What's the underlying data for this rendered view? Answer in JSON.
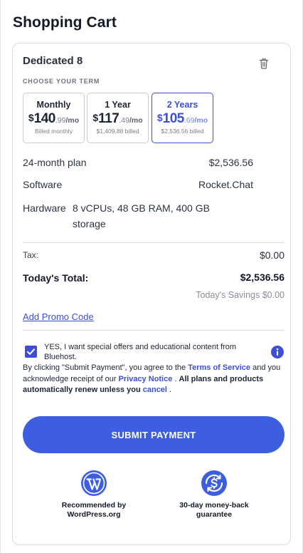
{
  "page": {
    "title": "Shopping Cart"
  },
  "cart": {
    "product_name": "Dedicated 8",
    "term_section_label": "CHOOSE YOUR TERM",
    "terms": [
      {
        "name": "Monthly",
        "currency": "$",
        "dollars": "140",
        "cents": ".99",
        "per": "/mo",
        "billed": "Billed monthly",
        "selected": false
      },
      {
        "name": "1 Year",
        "currency": "$",
        "dollars": "117",
        "cents": ".49",
        "per": "/mo",
        "billed": "$1,409.88 billed",
        "selected": false
      },
      {
        "name": "2 Years",
        "currency": "$",
        "dollars": "105",
        "cents": ".69",
        "per": "/mo",
        "billed": "$2,536.56 billed",
        "selected": true
      }
    ],
    "details": {
      "plan_label": "24-month plan",
      "plan_value": "$2,536.56",
      "software_label": "Software",
      "software_value": "Rocket.Chat",
      "hardware_label": "Hardware",
      "hardware_value": "8 vCPUs, 48 GB RAM, 400 GB storage"
    },
    "tax_label": "Tax:",
    "tax_value": "$0.00",
    "total_label": "Today's Total:",
    "total_value": "$2,536.56",
    "savings_text": "Today's Savings $0.00",
    "promo_link": "Add Promo Code",
    "optin": {
      "checked": true,
      "text": "YES, I want special offers and educational content from Bluehost."
    },
    "legal": {
      "part1": "By clicking \"Submit Payment\", you agree to the ",
      "tos_link": "Terms of Service",
      "part2": " and you acknowledge receipt of our ",
      "privacy_link": "Privacy Notice",
      "part3": " . ",
      "bold": " All plans and products automatically renew unless you ",
      "cancel_link": "cancel",
      "part4": " ."
    },
    "submit_label": "SUBMIT PAYMENT",
    "badges": [
      {
        "icon": "wordpress-icon",
        "caption": "Recommended by WordPress.org"
      },
      {
        "icon": "money-back-icon",
        "caption": "30-day money-back guarantee"
      }
    ]
  },
  "colors": {
    "accent": "#3d4fd8",
    "button": "#3d5ee0",
    "text": "#1f2433",
    "muted": "#8a8e99"
  }
}
